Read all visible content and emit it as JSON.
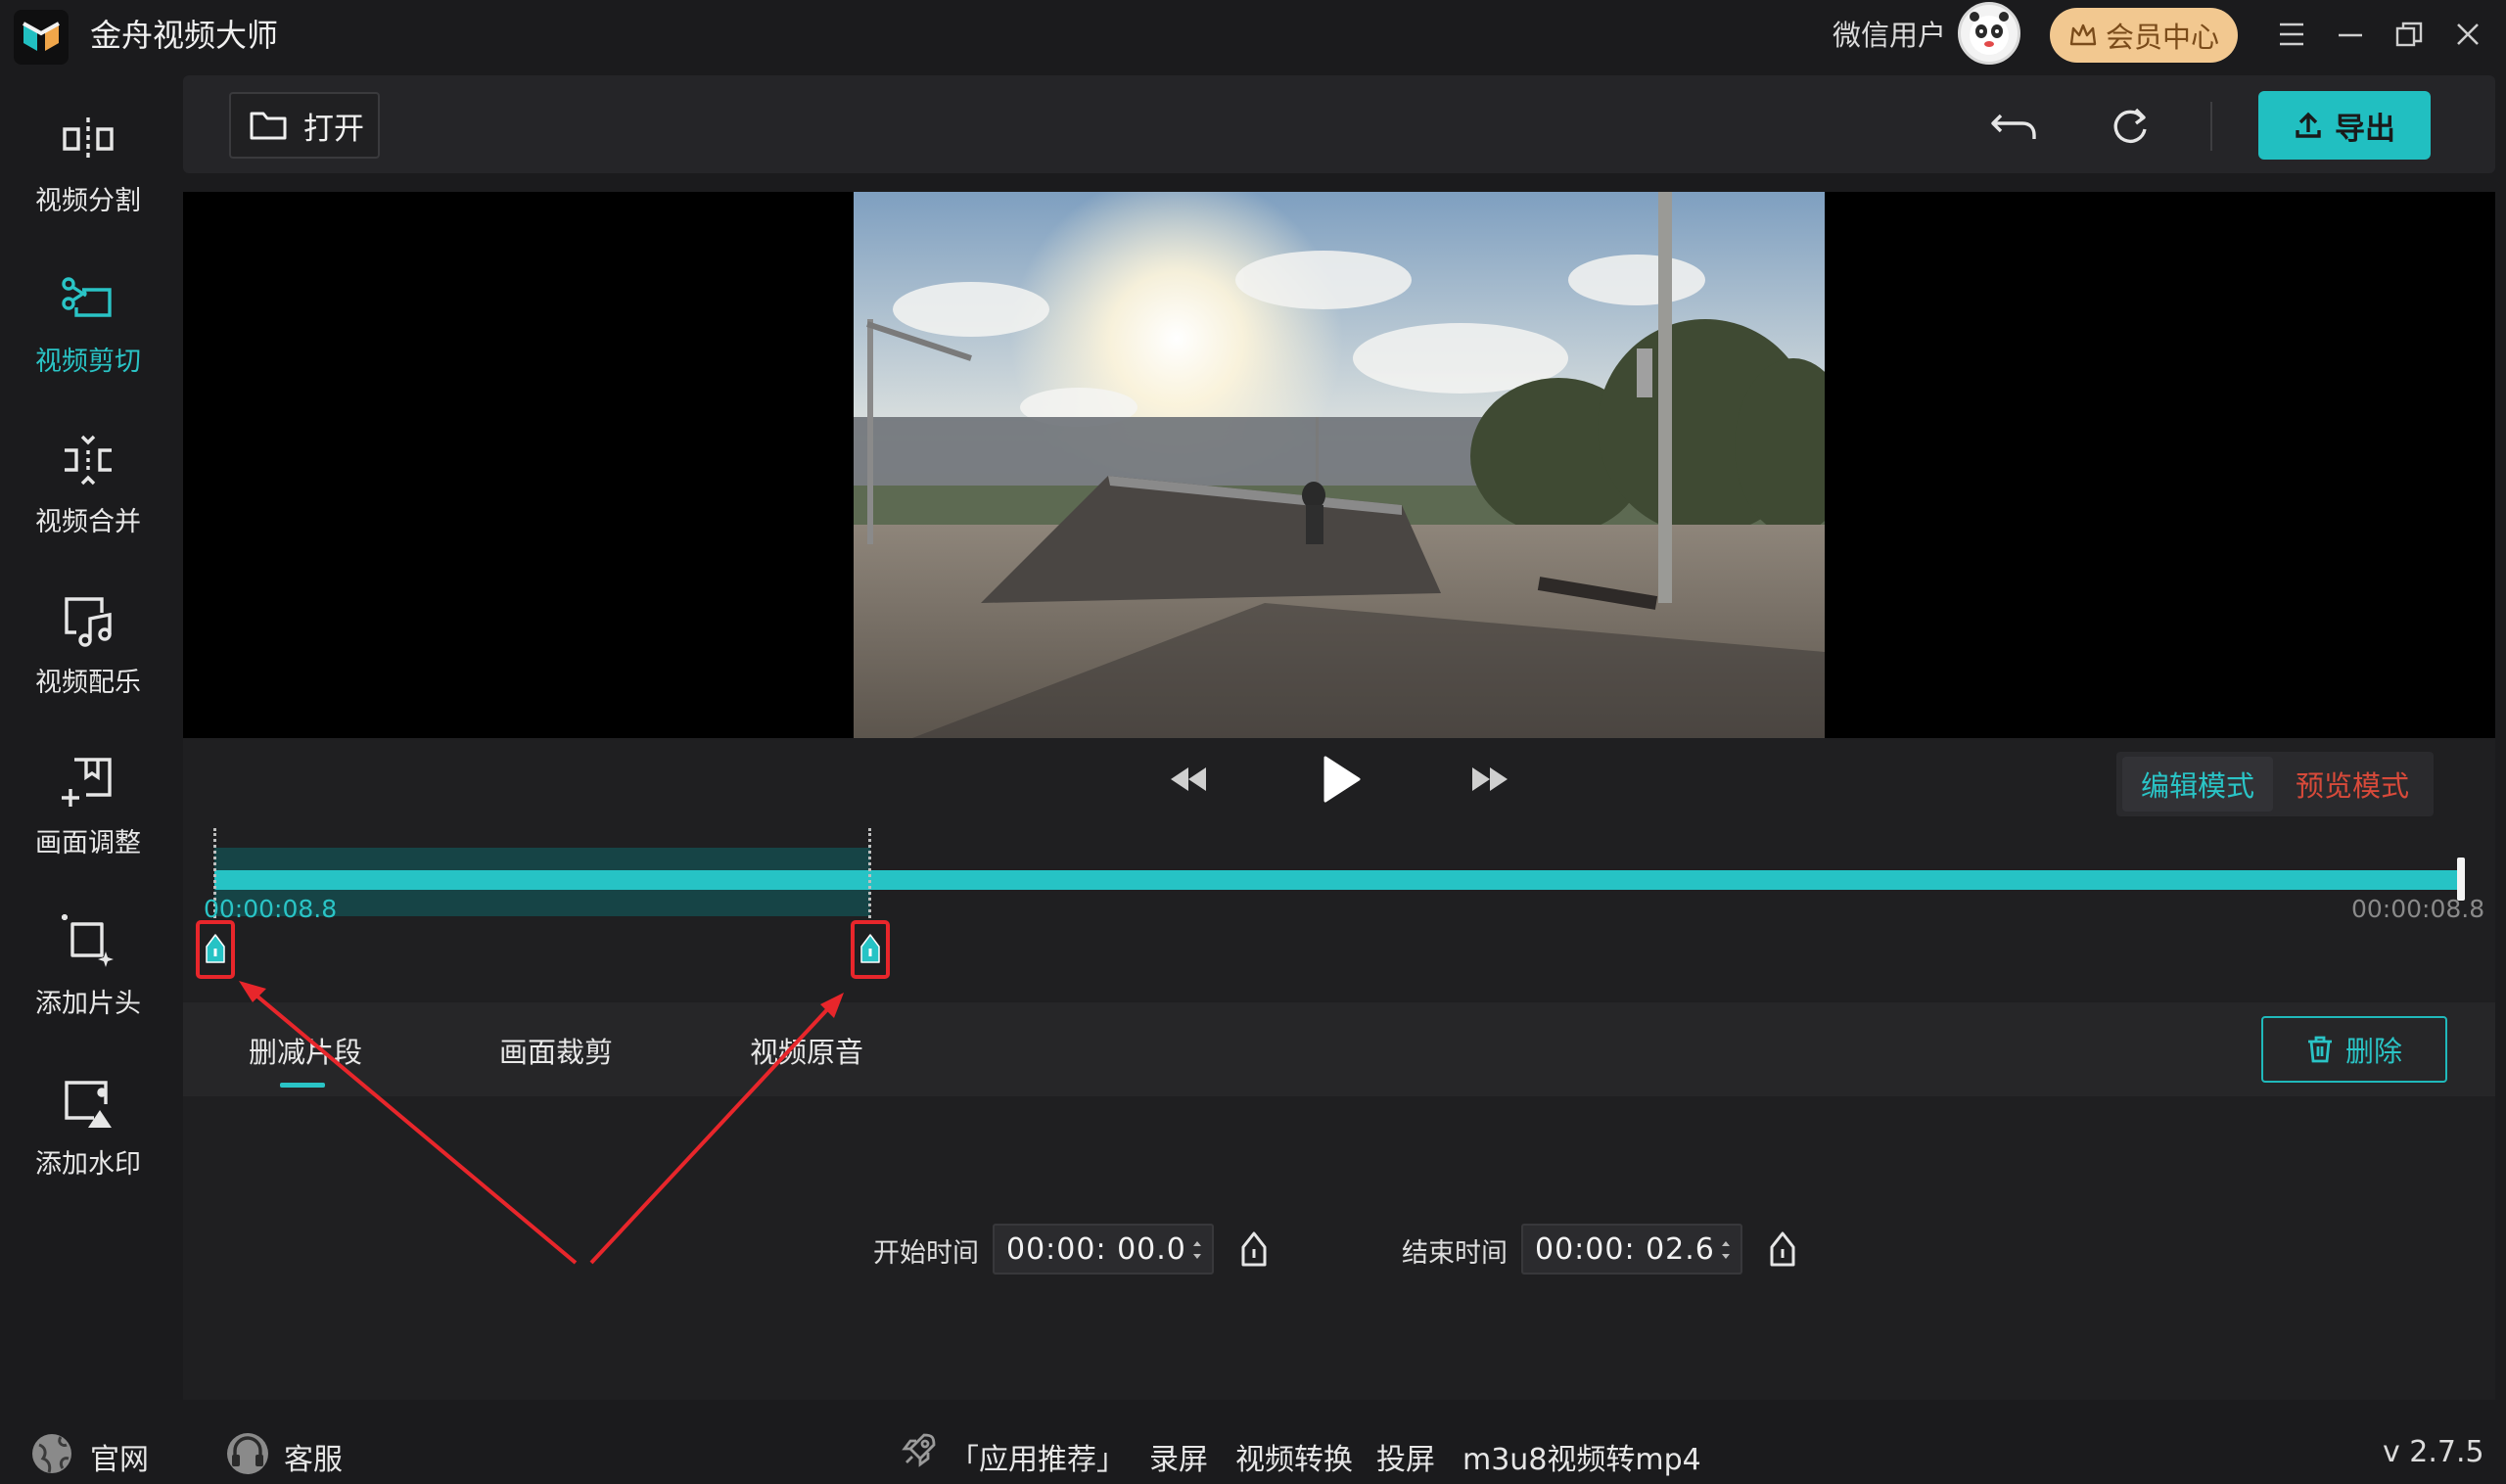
{
  "app": {
    "title": "金舟视频大师",
    "user_name": "微信用户",
    "vip_label": "会员中心",
    "version": "v 2.7.5"
  },
  "sidebar": {
    "items": [
      {
        "label": "视频分割",
        "icon": "split-icon",
        "active": false
      },
      {
        "label": "视频剪切",
        "icon": "scissors-icon",
        "active": true
      },
      {
        "label": "视频合并",
        "icon": "merge-icon",
        "active": false
      },
      {
        "label": "视频配乐",
        "icon": "music-note-icon",
        "active": false
      },
      {
        "label": "画面调整",
        "icon": "crop-adjust-icon",
        "active": false
      },
      {
        "label": "添加片头",
        "icon": "sparkle-frame-icon",
        "active": false
      },
      {
        "label": "添加水印",
        "icon": "watermark-icon",
        "active": false
      }
    ]
  },
  "toolbar": {
    "open_label": "打开",
    "export_label": "导出"
  },
  "modes": {
    "edit": "编辑模式",
    "preview": "预览模式"
  },
  "timeline": {
    "start_time": "00:00:08.8",
    "end_time": "00:00:08.8",
    "selection_start_fraction": 0.0,
    "selection_end_fraction": 0.29
  },
  "tabs": [
    {
      "label": "删减片段",
      "active": true
    },
    {
      "label": "画面裁剪",
      "active": false
    },
    {
      "label": "视频原音",
      "active": false
    }
  ],
  "panel": {
    "delete_label": "删除",
    "start_label": "开始时间",
    "start_value": "00:00: 00.0",
    "end_label": "结束时间",
    "end_value": "00:00: 02.6"
  },
  "footer": {
    "website": "官网",
    "support": "客服",
    "recommend": "「应用推荐」",
    "links": [
      "录屏",
      "视频转换",
      "投屏",
      "m3u8视频转mp4"
    ]
  },
  "colors": {
    "accent": "#21bfc1",
    "annotation": "#e8262b",
    "vip": "#f2c890",
    "preview_mode": "#d84a3a"
  }
}
